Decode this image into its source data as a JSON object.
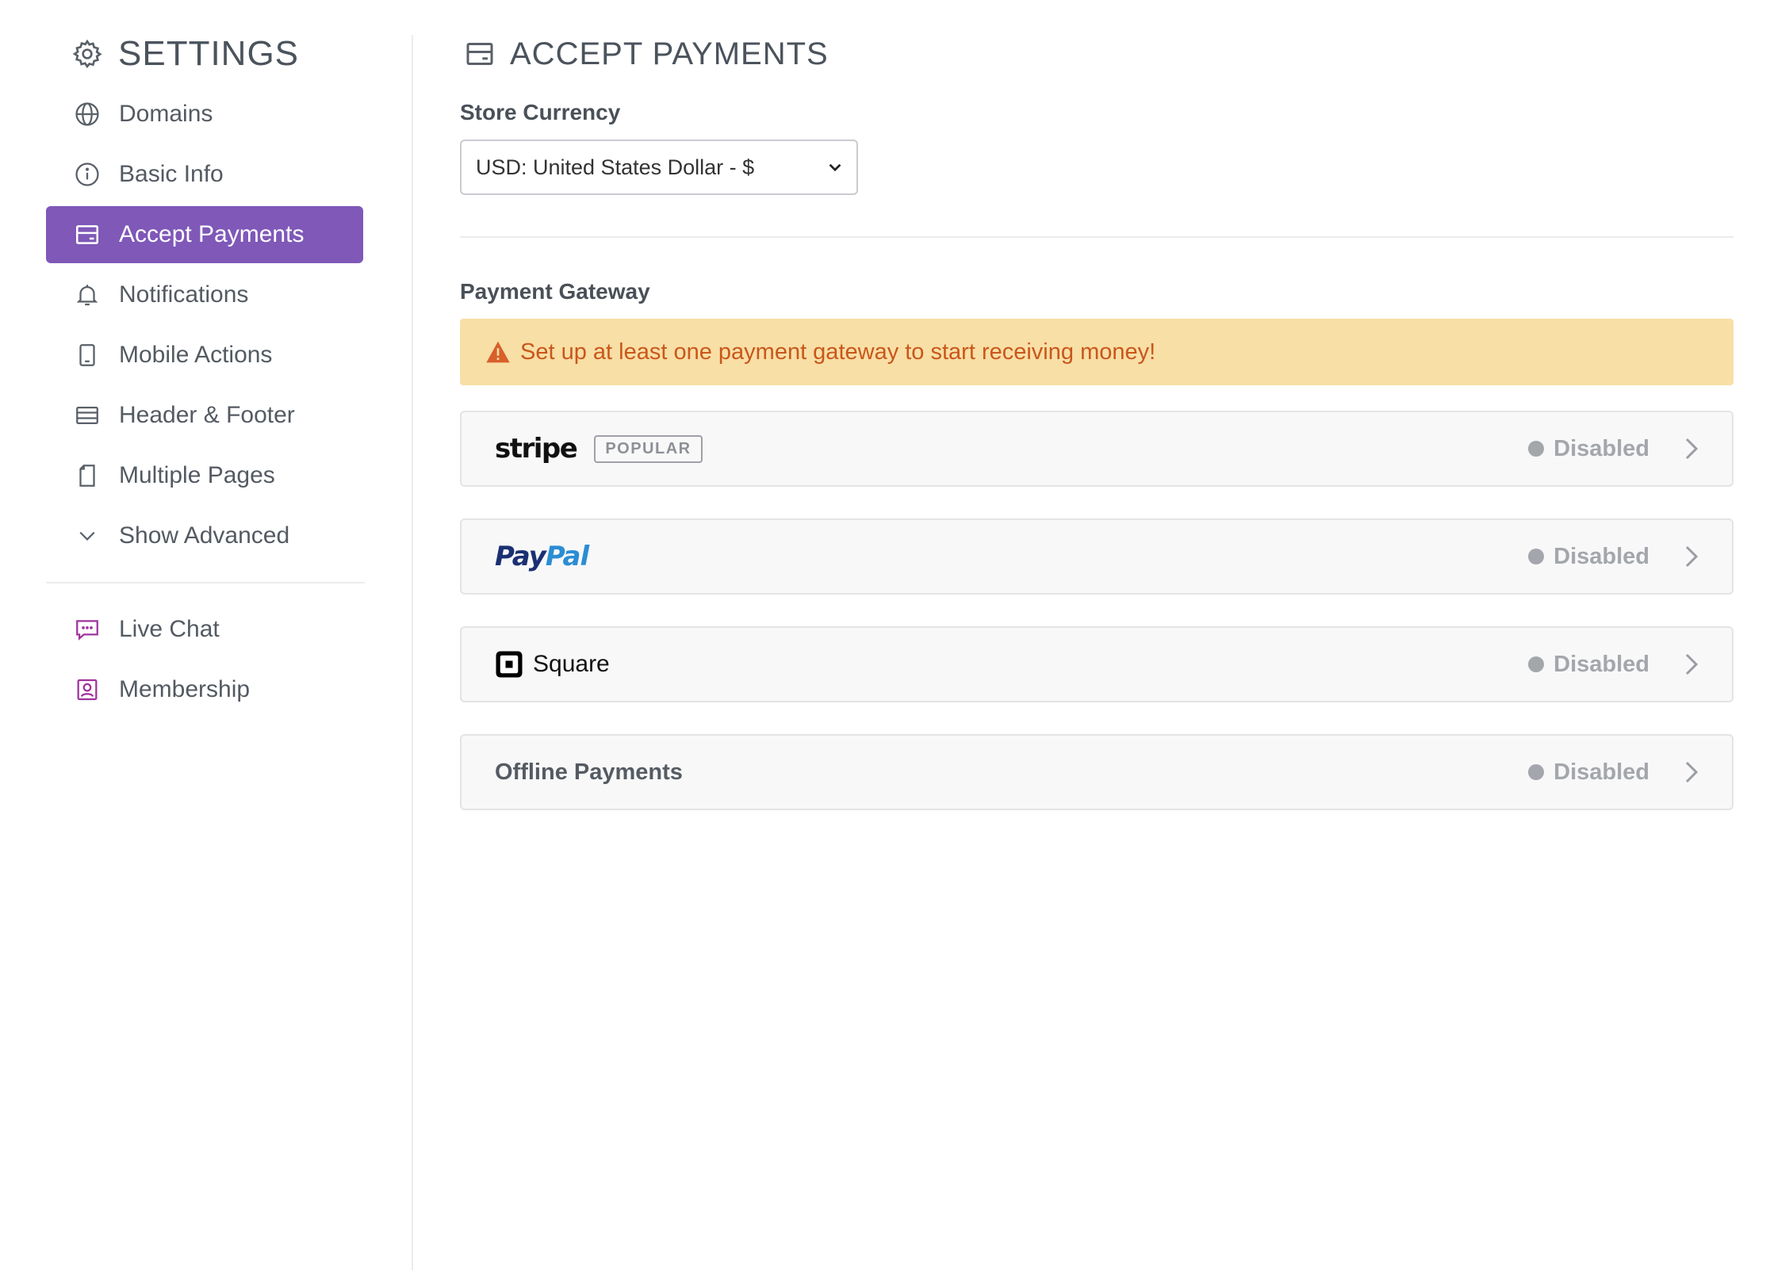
{
  "sidebar": {
    "title": "SETTINGS",
    "items": [
      {
        "label": "Domains",
        "icon": "globe-icon"
      },
      {
        "label": "Basic Info",
        "icon": "info-icon"
      },
      {
        "label": "Accept Payments",
        "icon": "payment-card-icon",
        "active": true
      },
      {
        "label": "Notifications",
        "icon": "bell-icon"
      },
      {
        "label": "Mobile Actions",
        "icon": "mobile-icon"
      },
      {
        "label": "Header & Footer",
        "icon": "layout-icon"
      },
      {
        "label": "Multiple Pages",
        "icon": "page-icon"
      },
      {
        "label": "Show Advanced",
        "icon": "chevron-down-icon"
      }
    ],
    "extra_items": [
      {
        "label": "Live Chat",
        "icon": "chat-icon"
      },
      {
        "label": "Membership",
        "icon": "member-icon"
      }
    ]
  },
  "main": {
    "title": "ACCEPT PAYMENTS",
    "store_currency": {
      "label": "Store Currency",
      "selected": "USD: United States Dollar - $"
    },
    "payment_gateway": {
      "label": "Payment Gateway",
      "alert": "Set up at least one payment gateway to start receiving money!",
      "gateways": [
        {
          "name": "stripe",
          "badge": "POPULAR",
          "status": "Disabled"
        },
        {
          "name_pay": "Pay",
          "name_pal": "Pal",
          "status": "Disabled"
        },
        {
          "name": "Square",
          "status": "Disabled"
        },
        {
          "name": "Offline Payments",
          "status": "Disabled"
        }
      ]
    }
  },
  "colors": {
    "accent": "#7f58b8",
    "alert_bg": "#f8dfa6",
    "alert_text": "#c9571b",
    "status_gray": "#a3a6ab"
  }
}
